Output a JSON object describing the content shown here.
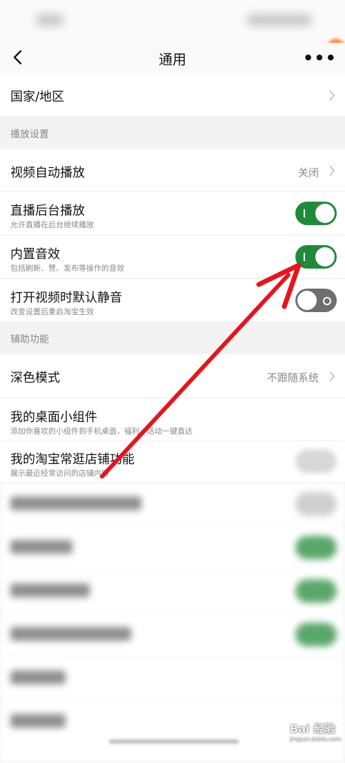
{
  "nav": {
    "title": "通用",
    "more_label": "•••"
  },
  "rows": {
    "region": {
      "label": "国家/地区"
    },
    "autoplay": {
      "label": "视频自动播放",
      "value": "关闭"
    },
    "bg_play": {
      "label": "直播后台播放",
      "sub": "允许直播在后台继续播放",
      "state": "on"
    },
    "sound": {
      "label": "内置音效",
      "sub": "包括刷新、赞、发布等操作的音效",
      "state": "on"
    },
    "mute": {
      "label": "打开视频时默认静音",
      "sub": "改变设置后重启淘宝生效",
      "state": "off"
    },
    "dark": {
      "label": "深色模式",
      "value": "不跟随系统"
    },
    "widget": {
      "label": "我的桌面小组件",
      "sub": "添加你喜欢的小组件到手机桌面，福利、活动一键直达"
    },
    "shop": {
      "label": "我的淘宝常逛店铺功能",
      "sub": "展示最近经常访问的店铺内容"
    }
  },
  "sections": {
    "playback": "播放设置",
    "assist": "辅助功能"
  },
  "colors": {
    "toggle_on": "#1f8a3a",
    "toggle_off": "#6e6e6e",
    "arrow": "#e8141c"
  },
  "watermark": {
    "brand": "Bai 经验",
    "url": "jingyan.baidu.com"
  }
}
